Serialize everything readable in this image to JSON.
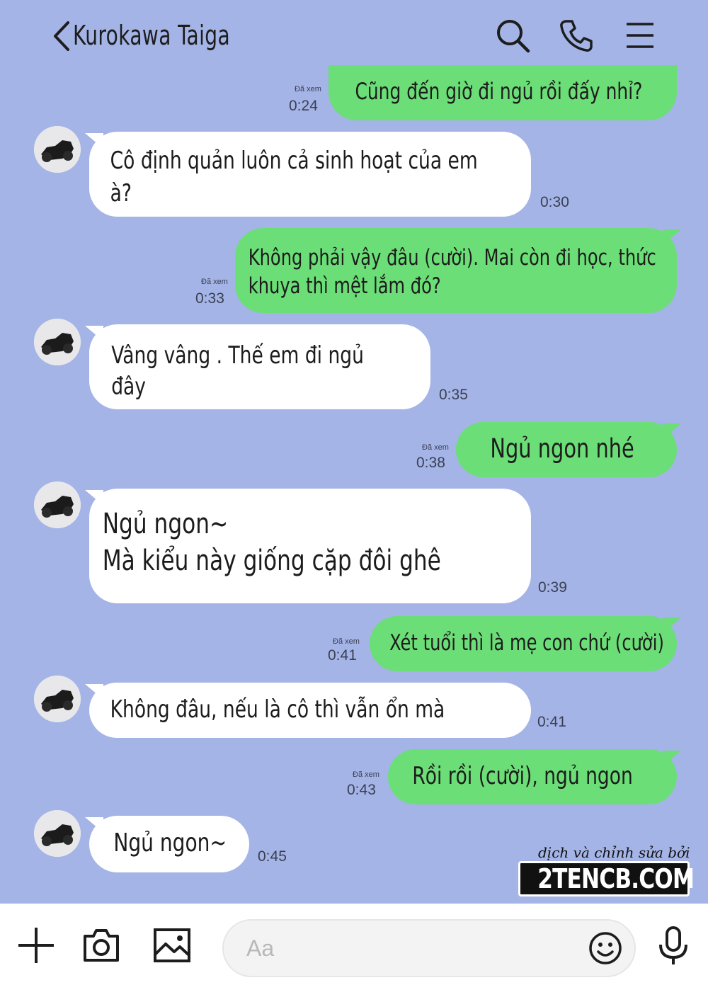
{
  "header": {
    "title": "Kurokawa Taiga",
    "icons": [
      "back-chevron-icon",
      "search-icon",
      "phone-icon",
      "menu-icon"
    ]
  },
  "messages": [
    {
      "dir": "out",
      "text": [
        "Cũng đến giờ đi ngủ rồi đấy nhỉ?"
      ],
      "read": "Đã xem",
      "time": "0:24"
    },
    {
      "dir": "in",
      "text": [
        "Cô định quản luôn cả sinh hoạt của em",
        "à?"
      ],
      "time": "0:30"
    },
    {
      "dir": "out",
      "text": [
        "Không phải vậy đâu (cười). Mai còn đi học, thức",
        "khuya thì mệt lắm đó?"
      ],
      "read": "Đã xem",
      "time": "0:33"
    },
    {
      "dir": "in",
      "text": [
        "Vâng vâng . Thế em đi ngủ",
        "đây"
      ],
      "time": "0:35"
    },
    {
      "dir": "out",
      "text": [
        "Ngủ ngon nhé"
      ],
      "read": "Đã xem",
      "time": "0:38"
    },
    {
      "dir": "in",
      "text": [
        "Ngủ ngon~",
        "Mà kiểu này giống cặp đôi ghê"
      ],
      "time": "0:39"
    },
    {
      "dir": "out",
      "text": [
        "Xét tuổi thì là mẹ con chứ (cười)"
      ],
      "read": "Đã xem",
      "time": "0:41"
    },
    {
      "dir": "in",
      "text": [
        "Không đâu, nếu là cô thì vẫn ổn mà"
      ],
      "time": "0:41"
    },
    {
      "dir": "out",
      "text": [
        "Rồi rồi (cười), ngủ ngon"
      ],
      "read": "Đã xem",
      "time": "0:43"
    },
    {
      "dir": "in",
      "text": [
        "Ngủ ngon~"
      ],
      "time": "0:45"
    }
  ],
  "watermark": {
    "credit": "dịch và chỉnh sửa bởi",
    "site": "2TENCB.COM"
  },
  "composer": {
    "placeholder": "Aa",
    "icons": [
      "plus-icon",
      "camera-icon",
      "image-icon",
      "emoji-icon",
      "microphone-icon"
    ]
  },
  "colors": {
    "background": "#a4b4e6",
    "outgoing_bubble": "#6bde77",
    "incoming_bubble": "#ffffff"
  }
}
